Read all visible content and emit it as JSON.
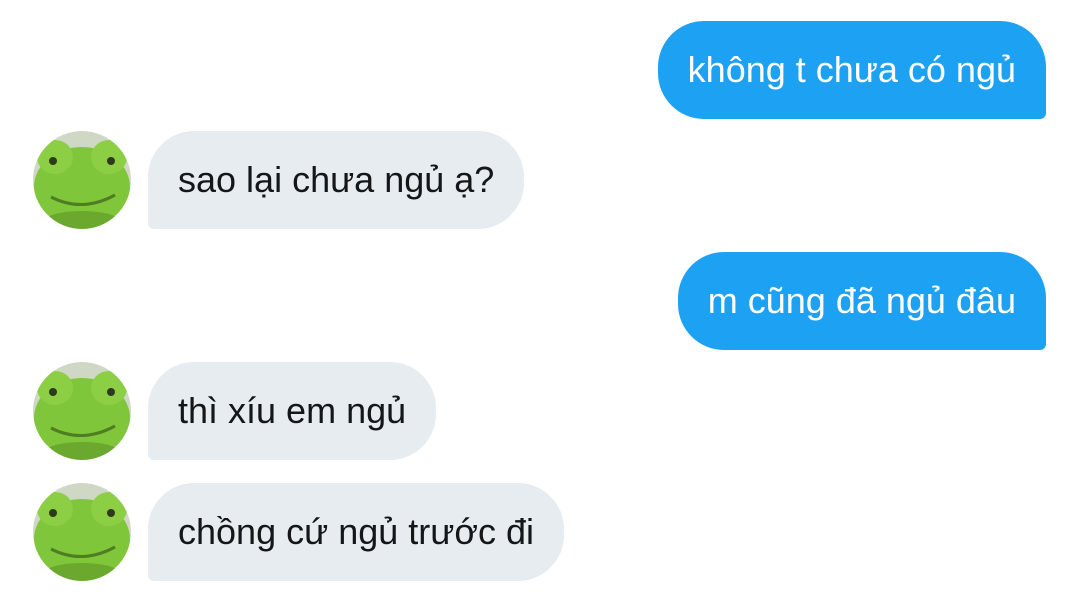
{
  "conversation": {
    "messages": [
      {
        "direction": "outgoing",
        "text": "không t chưa có ngủ"
      },
      {
        "direction": "incoming",
        "text": "sao lại chưa ngủ ạ?",
        "avatar_icon": "green-frog-plush-avatar"
      },
      {
        "direction": "outgoing",
        "text": "m cũng đã ngủ đâu"
      },
      {
        "direction": "incoming",
        "text": "thì xíu em ngủ",
        "avatar_icon": "green-frog-plush-avatar"
      },
      {
        "direction": "incoming",
        "text": "chồng cứ ngủ trước đi",
        "avatar_icon": "green-frog-plush-avatar"
      }
    ]
  },
  "colors": {
    "outgoing_bubble": "#1da1f2",
    "incoming_bubble": "#e6ecf0",
    "outgoing_text": "#ffffff",
    "incoming_text": "#14171a",
    "background": "#ffffff"
  }
}
